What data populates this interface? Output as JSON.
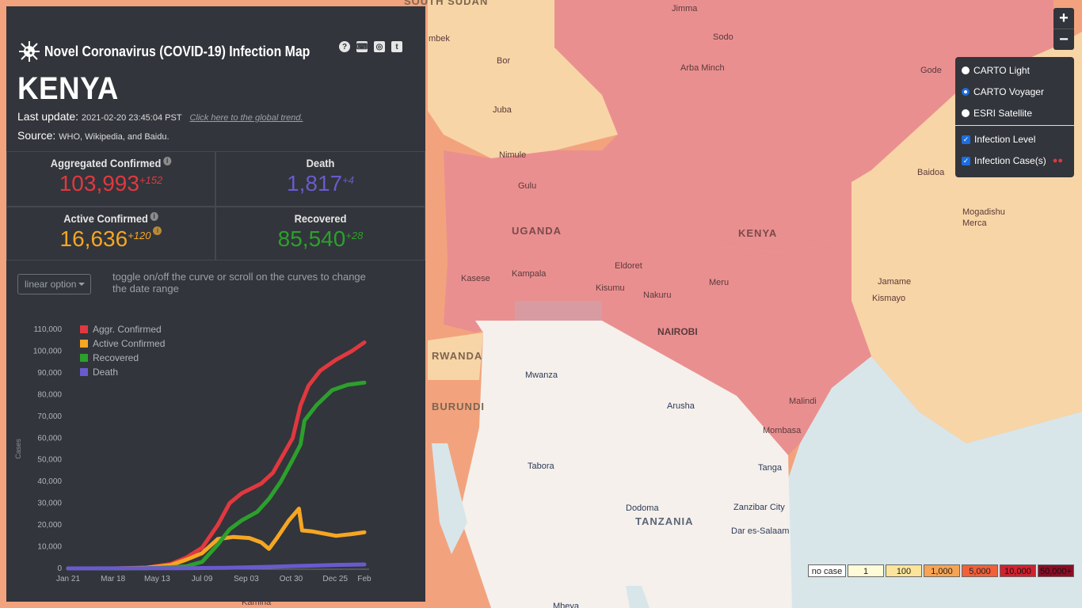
{
  "header": {
    "title": "Novel Coronavirus (COVID-19) Infection Map",
    "icons": [
      "help-icon",
      "keyboard-icon",
      "github-icon",
      "twitter-icon"
    ],
    "icon_glyphs": [
      "?",
      "⌨",
      "◎",
      "t"
    ]
  },
  "country": "KENYA",
  "last_update_label": "Last update:",
  "last_update_value": "2021-02-20 23:45:04 PST",
  "global_trend_link": "Click here to the global trend.",
  "source_label": "Source:",
  "source_value": "WHO, Wikipedia, and Baidu.",
  "stats": {
    "confirmed": {
      "label": "Aggregated Confirmed",
      "value": "103,993",
      "delta": "+152",
      "color": "#e1383f"
    },
    "death": {
      "label": "Death",
      "value": "1,817",
      "delta": "+4",
      "color": "#6a5acd"
    },
    "active": {
      "label": "Active Confirmed",
      "value": "16,636",
      "delta": "+120",
      "color": "#f5a623"
    },
    "recovered": {
      "label": "Recovered",
      "value": "85,540",
      "delta": "+28",
      "color": "#2ca02c"
    }
  },
  "controls": {
    "scale_option": "linear option",
    "hint": "toggle on/off the curve or scroll on the curves to change the date range"
  },
  "chart_data": {
    "type": "line",
    "ylabel": "Cases",
    "ylim": [
      0,
      110000
    ],
    "yticks": [
      "0",
      "10,000",
      "20,000",
      "30,000",
      "40,000",
      "50,000",
      "60,000",
      "70,000",
      "80,000",
      "90,000",
      "100,000",
      "110,000"
    ],
    "xticks": [
      "Jan 21",
      "Mar 18",
      "May 13",
      "Jul 09",
      "Sep 03",
      "Oct 30",
      "Dec 25",
      "Feb"
    ],
    "tick_positions_day": [
      0,
      57,
      113,
      170,
      226,
      283,
      339,
      376
    ],
    "series": [
      {
        "name": "Aggr. Confirmed",
        "color": "#e1383f",
        "points": [
          [
            0,
            0
          ],
          [
            60,
            0
          ],
          [
            100,
            400
          ],
          [
            130,
            2000
          ],
          [
            150,
            5000
          ],
          [
            170,
            9500
          ],
          [
            190,
            20000
          ],
          [
            205,
            30000
          ],
          [
            220,
            34500
          ],
          [
            245,
            39000
          ],
          [
            260,
            44000
          ],
          [
            285,
            60000
          ],
          [
            295,
            75000
          ],
          [
            305,
            84000
          ],
          [
            320,
            91000
          ],
          [
            340,
            96000
          ],
          [
            360,
            100000
          ],
          [
            376,
            104000
          ]
        ]
      },
      {
        "name": "Active Confirmed",
        "color": "#f5a623",
        "points": [
          [
            0,
            0
          ],
          [
            60,
            0
          ],
          [
            100,
            300
          ],
          [
            130,
            1500
          ],
          [
            150,
            4000
          ],
          [
            170,
            7000
          ],
          [
            190,
            13500
          ],
          [
            210,
            14500
          ],
          [
            230,
            14000
          ],
          [
            245,
            12000
          ],
          [
            255,
            9000
          ],
          [
            265,
            14000
          ],
          [
            280,
            22000
          ],
          [
            293,
            27500
          ],
          [
            297,
            17500
          ],
          [
            310,
            17000
          ],
          [
            340,
            15000
          ],
          [
            360,
            15800
          ],
          [
            376,
            16600
          ]
        ]
      },
      {
        "name": "Recovered",
        "color": "#2ca02c",
        "points": [
          [
            0,
            0
          ],
          [
            60,
            0
          ],
          [
            100,
            100
          ],
          [
            130,
            500
          ],
          [
            150,
            1000
          ],
          [
            170,
            3000
          ],
          [
            190,
            11000
          ],
          [
            205,
            18000
          ],
          [
            220,
            22000
          ],
          [
            240,
            26000
          ],
          [
            255,
            32000
          ],
          [
            270,
            40000
          ],
          [
            285,
            50000
          ],
          [
            295,
            57000
          ],
          [
            300,
            68000
          ],
          [
            315,
            75000
          ],
          [
            335,
            82000
          ],
          [
            355,
            84500
          ],
          [
            376,
            85500
          ]
        ]
      },
      {
        "name": "Death",
        "color": "#6a5acd",
        "points": [
          [
            0,
            0
          ],
          [
            150,
            100
          ],
          [
            200,
            300
          ],
          [
            250,
            700
          ],
          [
            300,
            1200
          ],
          [
            340,
            1600
          ],
          [
            376,
            1817
          ]
        ]
      }
    ]
  },
  "map": {
    "zoom_in": "+",
    "zoom_out": "−",
    "layers": [
      "CARTO Light",
      "CARTO Voyager",
      "ESRI Satellite"
    ],
    "selected_layer": "CARTO Voyager",
    "overlays": [
      "Infection Level",
      "Infection Case(s)"
    ],
    "overlays_checked": [
      true,
      true
    ],
    "country_labels": [
      "SOUTH SUDAN",
      "UGANDA",
      "KENYA",
      "RWANDA",
      "BURUNDI",
      "TANZANIA"
    ],
    "places": [
      "Jimma",
      "Sodo",
      "Arba Minch",
      "Gode",
      "Bor",
      "Juba",
      "Nimule",
      "Gulu",
      "Baidoa",
      "Mogadishu",
      "Merca",
      "Jamame",
      "Kismayo",
      "Kasese",
      "Kampala",
      "Eldoret",
      "Kisumu",
      "Nakuru",
      "Meru",
      "NAIROBI",
      "Mwanza",
      "Arusha",
      "Malindi",
      "Mombasa",
      "Tabora",
      "Tanga",
      "Dodoma",
      "Zanzibar City",
      "Dar es-Salaam",
      "Mbeya",
      "Kamina",
      "mbek"
    ],
    "legend": [
      {
        "label": "no case",
        "color": "#ffffff"
      },
      {
        "label": "1",
        "color": "#fffbd9"
      },
      {
        "label": "100",
        "color": "#fde49b"
      },
      {
        "label": "1,000",
        "color": "#f6a453"
      },
      {
        "label": "5,000",
        "color": "#f0603a"
      },
      {
        "label": "10,000",
        "color": "#d1212f"
      },
      {
        "label": "50,000+",
        "color": "#8b0d25"
      }
    ]
  }
}
